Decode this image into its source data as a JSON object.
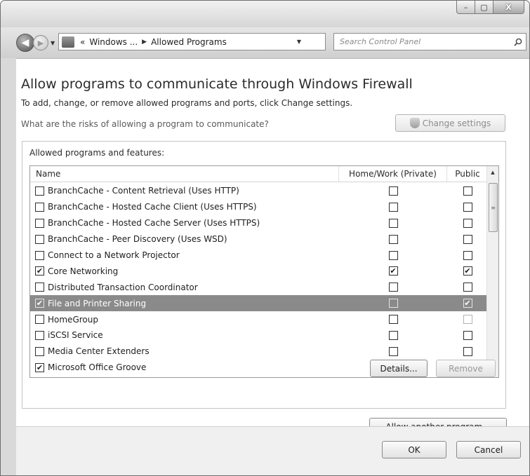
{
  "window": {
    "minimize_glyph": "–",
    "maximize_glyph": "▢",
    "close_glyph": "X"
  },
  "nav": {
    "back_glyph": "◀",
    "forward_glyph": "▶",
    "history_glyph": "▼",
    "address_prefix": "«",
    "address_crumb_1": "Windows ...",
    "address_sep": "▶",
    "address_crumb_2": "Allowed Programs",
    "address_drop": "▼",
    "refresh_glyph": "↻",
    "search_placeholder": "Search Control Panel"
  },
  "page": {
    "title": "Allow programs to communicate through Windows Firewall",
    "subtitle": "To add, change, or remove allowed programs and ports, click Change settings.",
    "risk_link": "What are the risks of allowing a program to communicate?",
    "change_settings_label": "Change settings"
  },
  "programs": {
    "group_label": "Allowed programs and features:",
    "columns": {
      "name": "Name",
      "home": "Home/Work (Private)",
      "public": "Public"
    },
    "check_glyph": "✔",
    "rows": [
      {
        "name": "BranchCache - Content Retrieval (Uses HTTP)",
        "enabled": false,
        "home": false,
        "public": false,
        "selected": false
      },
      {
        "name": "BranchCache - Hosted Cache Client (Uses HTTPS)",
        "enabled": false,
        "home": false,
        "public": false,
        "selected": false
      },
      {
        "name": "BranchCache - Hosted Cache Server (Uses HTTPS)",
        "enabled": false,
        "home": false,
        "public": false,
        "selected": false
      },
      {
        "name": "BranchCache - Peer Discovery (Uses WSD)",
        "enabled": false,
        "home": false,
        "public": false,
        "selected": false
      },
      {
        "name": "Connect to a Network Projector",
        "enabled": false,
        "home": false,
        "public": false,
        "selected": false
      },
      {
        "name": "Core Networking",
        "enabled": true,
        "home": true,
        "public": true,
        "selected": false
      },
      {
        "name": "Distributed Transaction Coordinator",
        "enabled": false,
        "home": false,
        "public": false,
        "selected": false
      },
      {
        "name": "File and Printer Sharing",
        "enabled": true,
        "home": false,
        "public": true,
        "selected": true
      },
      {
        "name": "HomeGroup",
        "enabled": false,
        "home": false,
        "public": false,
        "selected": false,
        "public_disabled": true
      },
      {
        "name": "iSCSI Service",
        "enabled": false,
        "home": false,
        "public": false,
        "selected": false
      },
      {
        "name": "Media Center Extenders",
        "enabled": false,
        "home": false,
        "public": false,
        "selected": false
      },
      {
        "name": "Microsoft Office Groove",
        "enabled": true,
        "home": false,
        "public": true,
        "selected": false
      }
    ],
    "details_label": "Details...",
    "remove_label": "Remove",
    "allow_another_label": "Allow another program..."
  },
  "footer": {
    "ok_label": "OK",
    "cancel_label": "Cancel"
  },
  "scroll": {
    "up_glyph": "▲",
    "down_glyph": "▼",
    "grip_glyph": "≡"
  }
}
